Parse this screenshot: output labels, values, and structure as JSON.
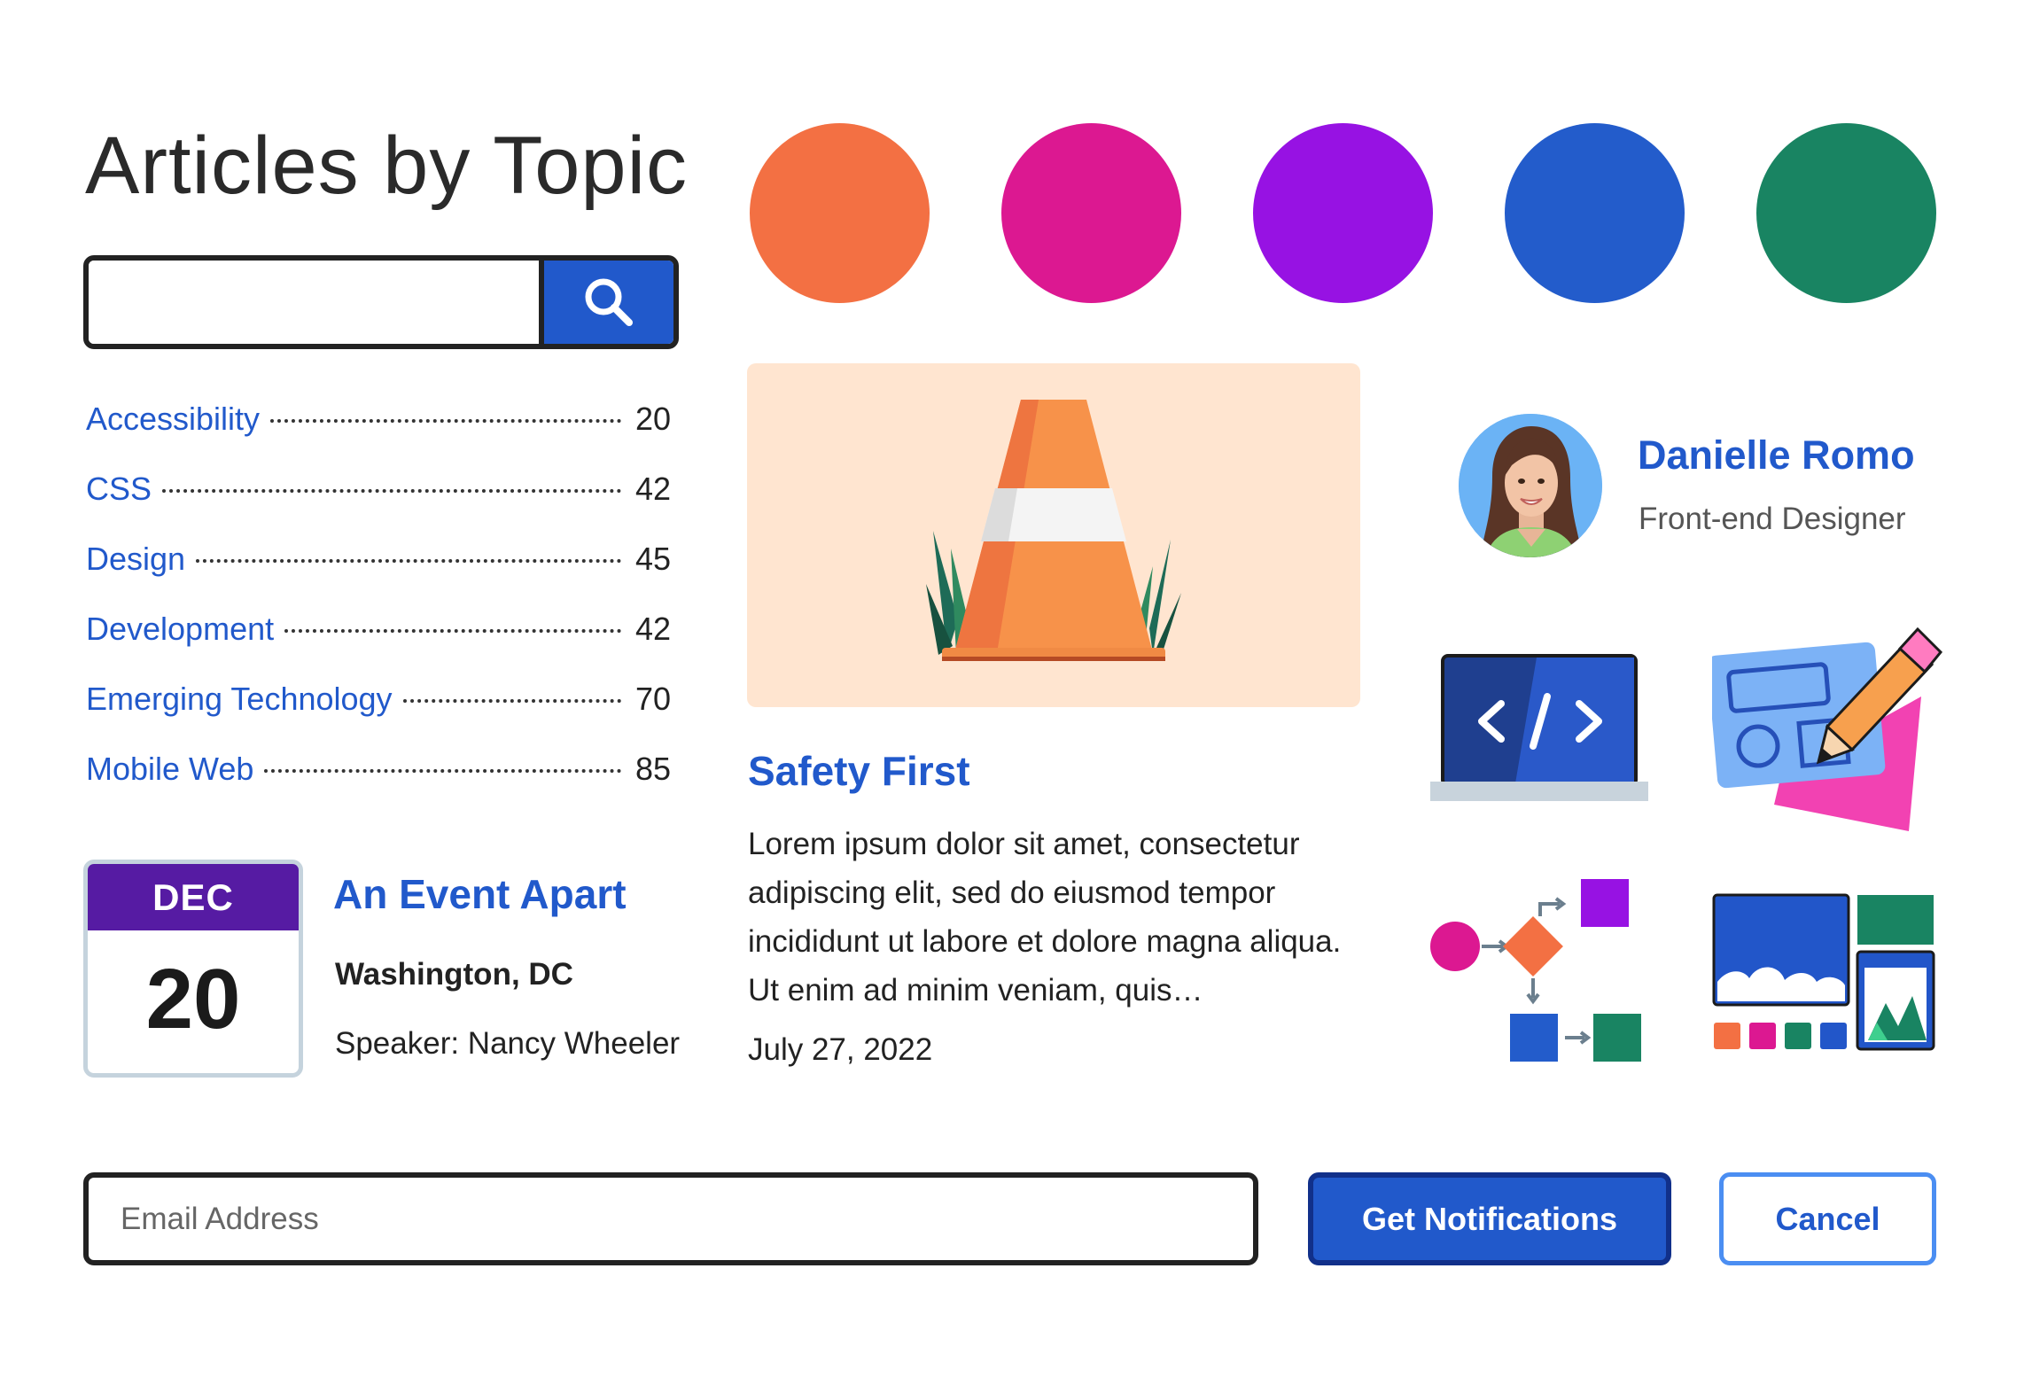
{
  "header": {
    "title": "Articles by Topic"
  },
  "search": {
    "placeholder": "",
    "button_icon": "search-icon"
  },
  "topics": [
    {
      "label": "Accessibility",
      "count": "20"
    },
    {
      "label": "CSS",
      "count": "42"
    },
    {
      "label": "Design",
      "count": "45"
    },
    {
      "label": "Development",
      "count": "42"
    },
    {
      "label": "Emerging Technology",
      "count": "70"
    },
    {
      "label": "Mobile Web",
      "count": "85"
    }
  ],
  "event": {
    "month": "DEC",
    "day": "20",
    "title": "An Event Apart",
    "location": "Washington, DC",
    "speaker": "Speaker: Nancy Wheeler"
  },
  "swatches": [
    "#f37043",
    "#dc1891",
    "#9712e3",
    "#235ccb",
    "#198462"
  ],
  "article": {
    "image_icon": "traffic-cone-icon",
    "title": "Safety First",
    "body": "Lorem ipsum dolor sit amet, consectetur adipiscing elit, sed do eiusmod tempor incididunt ut labore et dolore magna aliqua. Ut enim ad minim veniam, quis…",
    "date": "July 27, 2022"
  },
  "profile": {
    "name": "Danielle Romo",
    "role": "Front-end Designer"
  },
  "illustrations": [
    "code-laptop-icon",
    "design-pencil-icon",
    "flowchart-icon",
    "layout-grid-icon"
  ],
  "form": {
    "email_placeholder": "Email Address",
    "email_value": "",
    "submit_label": "Get Notifications",
    "cancel_label": "Cancel"
  },
  "colors": {
    "accent": "#2159cb",
    "text": "#222222",
    "event_header": "#561ba3",
    "card_bg": "#ffe5d0"
  }
}
